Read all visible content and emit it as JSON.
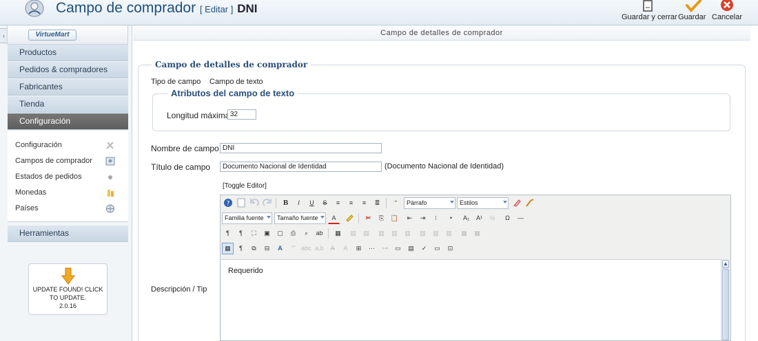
{
  "header": {
    "title": "Campo de comprador",
    "edit_tag": "[ Editar ]",
    "record": "DNI",
    "buttons": {
      "save_close": "Guardar y cerrar",
      "save": "Guardar",
      "cancel": "Cancelar"
    }
  },
  "sidebar": {
    "logo": "VirtueMart",
    "menu": [
      "Productos",
      "Pedidos & compradores",
      "Fabricantes",
      "Tienda",
      "Configuración"
    ],
    "sub_items": [
      "Configuración",
      "Campos de comprador",
      "Estados de pedidos",
      "Monedas",
      "Países"
    ],
    "tools": "Herramientas",
    "update": {
      "line1": "UPDATE FOUND! CLICK",
      "line2": "TO UPDATE.",
      "version": "2.0.16"
    }
  },
  "main": {
    "title": "Campo de detalles de comprador",
    "fieldset_legend": "Campo de detalles de comprador",
    "type_label": "Tipo de campo",
    "type_value": "Campo de texto",
    "attrs_legend": "Atributos del campo de texto",
    "maxlen_label": "Longitud máxima",
    "maxlen_value": "32",
    "name_label": "Nombre de campo",
    "name_value": "DNI",
    "title_label": "Título de campo",
    "title_value": "Documento Nacional de Identidad",
    "title_preview": "(Documento Nacional de Identidad)",
    "toggle_editor": "[Toggle Editor]",
    "desc_label": "Descripción / Tip",
    "editor": {
      "format_select": "Párrafo",
      "styles_select": "Estilos",
      "font_family_select": "Familia fuente",
      "font_size_select": "Tamaño fuente",
      "content": "Requerido"
    }
  }
}
